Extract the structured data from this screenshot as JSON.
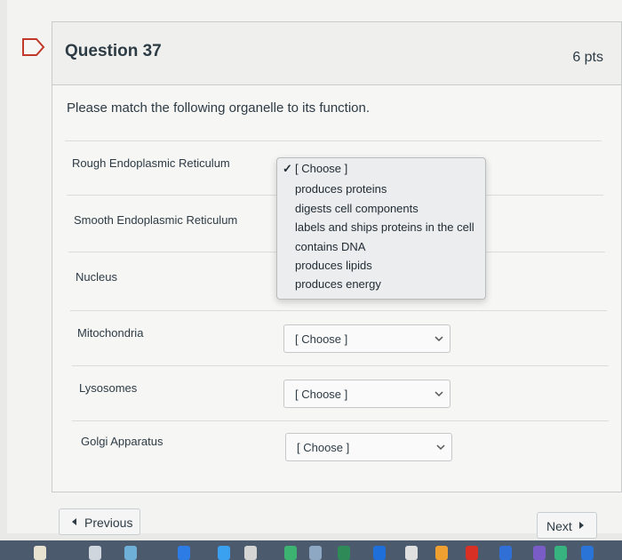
{
  "question": {
    "title": "Question 37",
    "points": "6 pts",
    "prompt": "Please match the following organelle to its function."
  },
  "rows": [
    {
      "term": "Rough Endoplasmic Reticulum"
    },
    {
      "term": "Smooth Endoplasmic Reticulum"
    },
    {
      "term": "Nucleus"
    },
    {
      "term": "Mitochondria",
      "select_value": "[ Choose ]"
    },
    {
      "term": "Lysosomes",
      "select_value": "[ Choose ]"
    },
    {
      "term": "Golgi Apparatus",
      "select_value": "[ Choose ]"
    }
  ],
  "dropdown": {
    "options": [
      "[ Choose ]",
      "produces proteins",
      "digests cell components",
      "labels and ships proteins in the cell",
      "contains DNA",
      "produces lipids",
      "produces energy"
    ],
    "selected_index": 0,
    "check_glyph": "✓"
  },
  "nav": {
    "previous_label": "Previous",
    "next_label": "Next"
  },
  "colors": {
    "flag_border": "#c0392b",
    "text": "#2d3b45",
    "taskbar": "#4c5a6e"
  }
}
